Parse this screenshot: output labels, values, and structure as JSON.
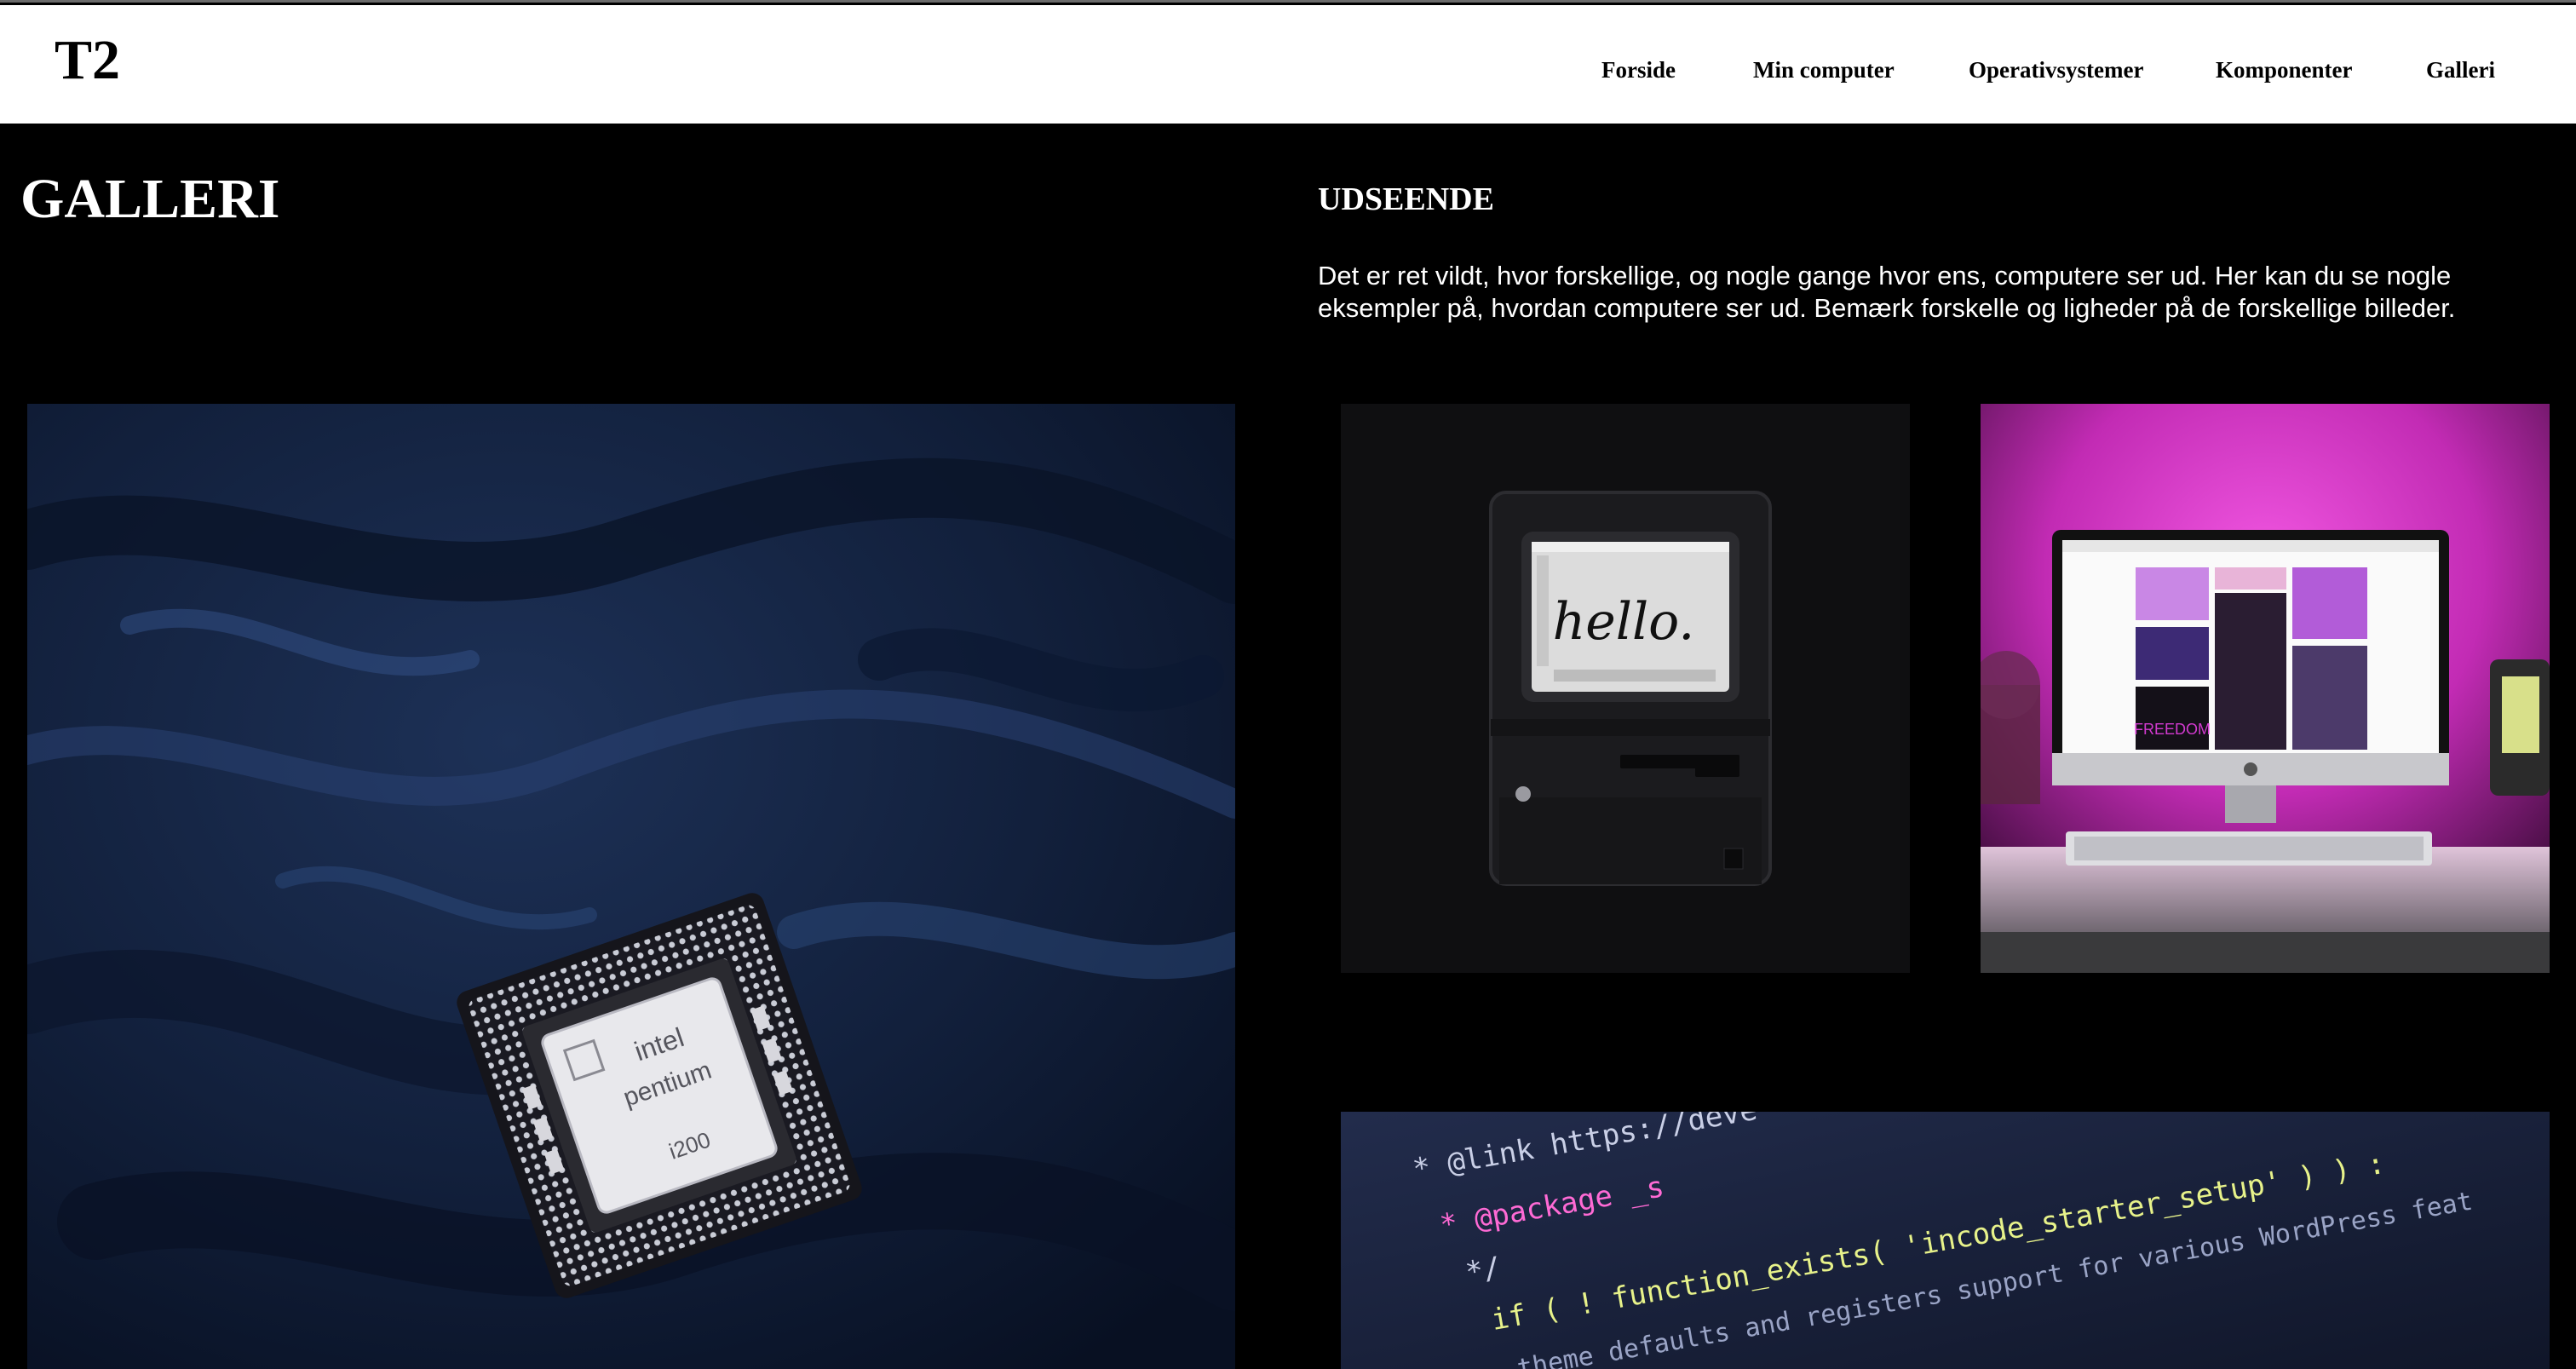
{
  "header": {
    "logo": "T2",
    "nav": [
      {
        "label": "Forside"
      },
      {
        "label": "Min computer"
      },
      {
        "label": "Operativsystemer"
      },
      {
        "label": "Komponenter"
      },
      {
        "label": "Galleri"
      }
    ]
  },
  "page": {
    "title": "GALLERI"
  },
  "section": {
    "title": "UDSEENDE",
    "text": "Det er ret vildt, hvor forskellige, og nogle gange hvor ens, computere ser ud. Her kan du se nogle eksempler på, hvordan computere ser ud. Bemærk forskelle og ligheder på de forskellige billeder."
  },
  "gallery": {
    "cpu": {
      "brand": "intel",
      "model": "pentium",
      "speed": "i200"
    },
    "mac": {
      "screen_text": "hello."
    },
    "imac": {
      "wallpaper_text": "FREEDOM"
    },
    "code": {
      "lines": [
        "* @link https://deve",
        "* @package _s",
        "*/",
        "if ( ! function_exists( 'incode_starter_setup' ) ) :",
        "theme defaults and registers support for various WordPress feat"
      ]
    }
  },
  "colors": {
    "background": "#000000",
    "header_bg": "#ffffff",
    "text_light": "#ffffff",
    "text_dark": "#000000",
    "code_bg": "#1a2340",
    "imac_glow": "#d633c8"
  }
}
